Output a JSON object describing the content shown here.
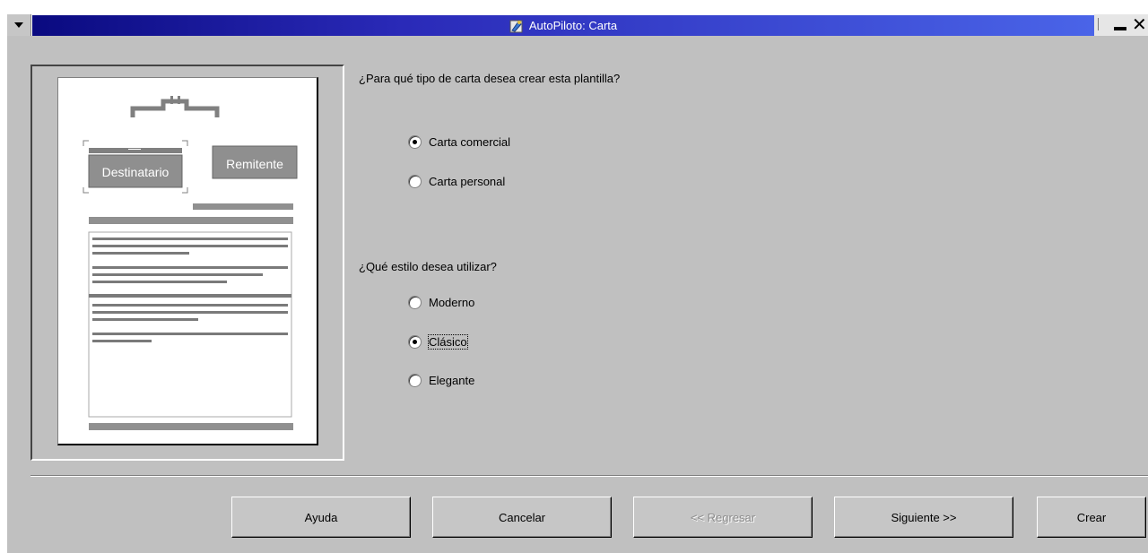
{
  "window": {
    "title": "AutoPiloto: Carta"
  },
  "preview": {
    "recipient_label": "Destinatario",
    "sender_label": "Remitente"
  },
  "letter_type": {
    "question": "¿Para qué tipo de carta desea crear esta plantilla?",
    "options": [
      {
        "label": "Carta comercial",
        "checked": true
      },
      {
        "label": "Carta personal",
        "checked": false
      }
    ]
  },
  "style": {
    "question": "¿Qué estilo desea utilizar?",
    "options": [
      {
        "label": "Moderno",
        "checked": false
      },
      {
        "label": "Clásico",
        "checked": true
      },
      {
        "label": "Elegante",
        "checked": false
      }
    ]
  },
  "buttons": {
    "help": "Ayuda",
    "cancel": "Cancelar",
    "back": "<< Regresar",
    "next": "Siguiente >>",
    "create": "Crear"
  }
}
